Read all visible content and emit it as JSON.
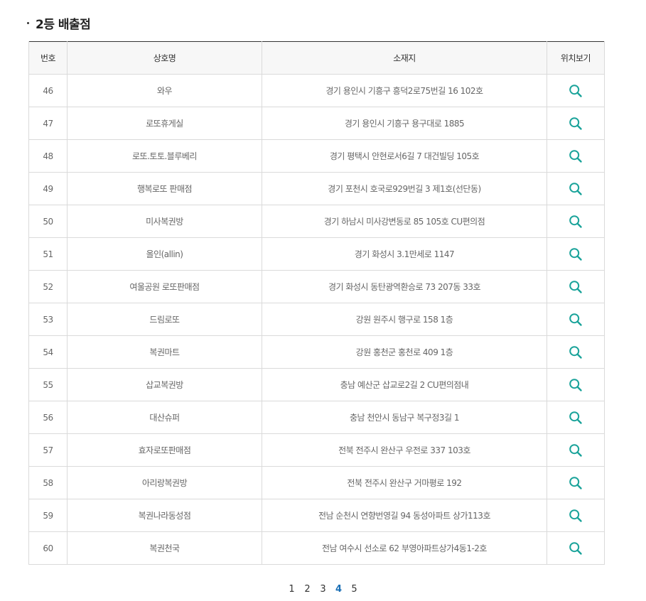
{
  "section": {
    "title": "2등 배출점"
  },
  "table": {
    "headers": {
      "no": "번호",
      "name": "상호명",
      "address": "소재지",
      "location": "위치보기"
    },
    "rows": [
      {
        "no": "46",
        "name": "와우",
        "address": "경기 용인시 기흥구 흥덕2로75번길 16 102호"
      },
      {
        "no": "47",
        "name": "로또휴게실",
        "address": "경기 용인시 기흥구 용구대로 1885"
      },
      {
        "no": "48",
        "name": "로또.토토.블루베리",
        "address": "경기 평택시 안현로서6길 7 대건빌딩 105호"
      },
      {
        "no": "49",
        "name": "행복로또 판매점",
        "address": "경기 포천시 호국로929번길 3 제1호(선단동)"
      },
      {
        "no": "50",
        "name": "미사복권방",
        "address": "경기 하남시 미사강변동로 85 105호 CU편의점"
      },
      {
        "no": "51",
        "name": "올인(allin)",
        "address": "경기 화성시 3.1만세로 1147"
      },
      {
        "no": "52",
        "name": "여울공원 로또판매점",
        "address": "경기 화성시 동탄광역환승로 73 207동 33호"
      },
      {
        "no": "53",
        "name": "드림로또",
        "address": "강원 원주시 행구로 158 1층"
      },
      {
        "no": "54",
        "name": "복권마트",
        "address": "강원 홍천군 홍천로 409 1층"
      },
      {
        "no": "55",
        "name": "삽교복권방",
        "address": "충남 예산군 삽교로2길 2 CU편의점내"
      },
      {
        "no": "56",
        "name": "대산슈퍼",
        "address": "충남 천안시 동남구 복구정3길 1"
      },
      {
        "no": "57",
        "name": "효자로또판매점",
        "address": "전북 전주시 완산구 우전로 337 103호"
      },
      {
        "no": "58",
        "name": "아리랑복권방",
        "address": "전북 전주시 완산구 거마평로 192"
      },
      {
        "no": "59",
        "name": "복권나라동성점",
        "address": "전남 순천시 연향번영길 94 동성아파트 상가113호"
      },
      {
        "no": "60",
        "name": "복권천국",
        "address": "전남 여수시 선소로 62 부영아파트상가4동1-2호"
      }
    ],
    "row_icon": "search-icon",
    "icon_color": "#1aa39a"
  },
  "pagination": {
    "pages": [
      "1",
      "2",
      "3",
      "4",
      "5"
    ],
    "current": "4",
    "current_color": "#1a6fb5"
  }
}
